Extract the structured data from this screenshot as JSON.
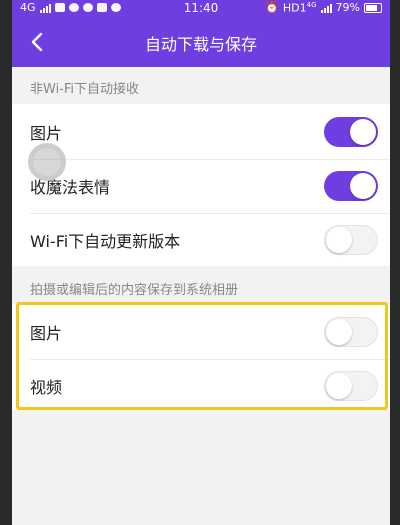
{
  "status_bar": {
    "network": "4G",
    "time": "11:40",
    "right_network": "HD1",
    "right_network_sup": "4G",
    "battery": "79%"
  },
  "header": {
    "title": "自动下载与保存",
    "back_icon": "chevron-left-icon"
  },
  "sections": [
    {
      "title": "非Wi-Fi下自动接收",
      "items": [
        {
          "label": "图片",
          "toggle": "on"
        },
        {
          "label": "收魔法表情",
          "toggle": "on"
        },
        {
          "label": "Wi-Fi下自动更新版本",
          "toggle": "off"
        }
      ]
    },
    {
      "title": "拍摄或编辑后的内容保存到系统相册",
      "items": [
        {
          "label": "图片",
          "toggle": "off"
        },
        {
          "label": "视频",
          "toggle": "off"
        }
      ]
    }
  ],
  "colors": {
    "accent": "#6f3ee0",
    "highlight": "#f5c518",
    "background": "#f2f2f2"
  }
}
